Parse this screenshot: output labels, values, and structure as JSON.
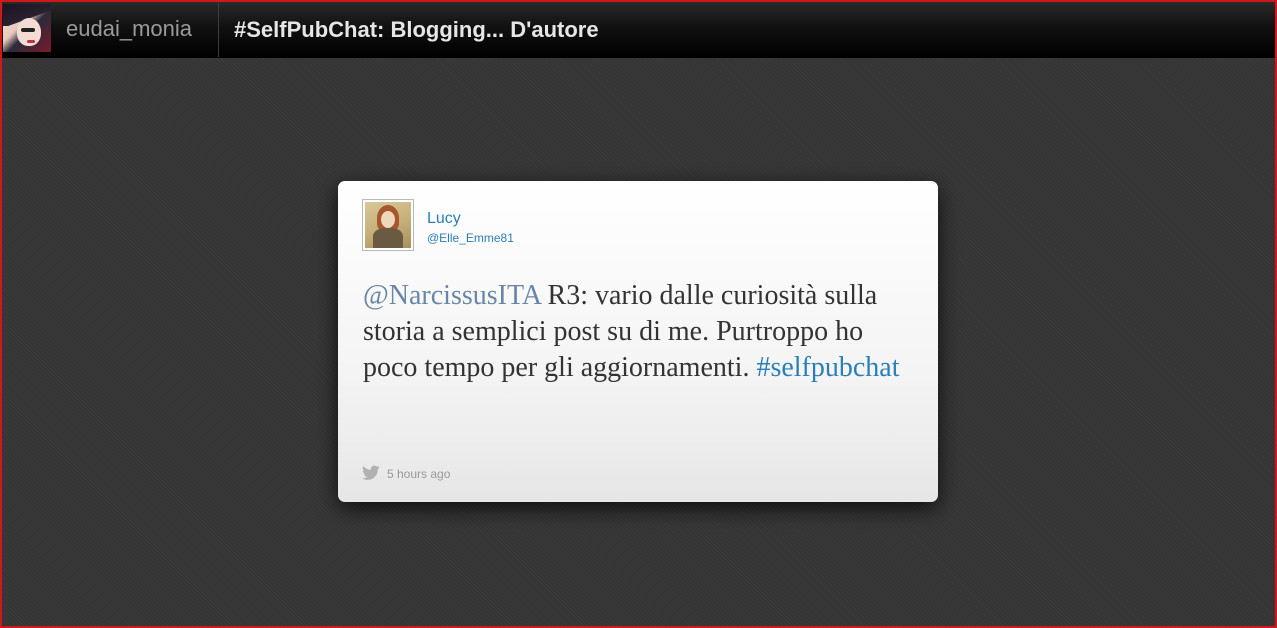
{
  "header": {
    "username": "eudai_monia",
    "title": "#SelfPubChat: Blogging... D'autore",
    "avatar_icon": "profile-photo-icon"
  },
  "tweet": {
    "author_name": "Lucy",
    "author_handle": "@Elle_Emme81",
    "mention": "@NarcissusITA",
    "body": " R3: vario dalle curiosità sulla storia a semplici post su di me. Purtroppo ho poco tempo per gli aggiornamenti. ",
    "hashtag": "#selfpubchat",
    "timestamp": "5 hours ago",
    "source_icon": "twitter-bird-icon"
  },
  "colors": {
    "frame_border": "#d01818",
    "link": "#2a7fb8",
    "mention": "#6a86a6",
    "text": "#333333",
    "background": "#353535"
  }
}
